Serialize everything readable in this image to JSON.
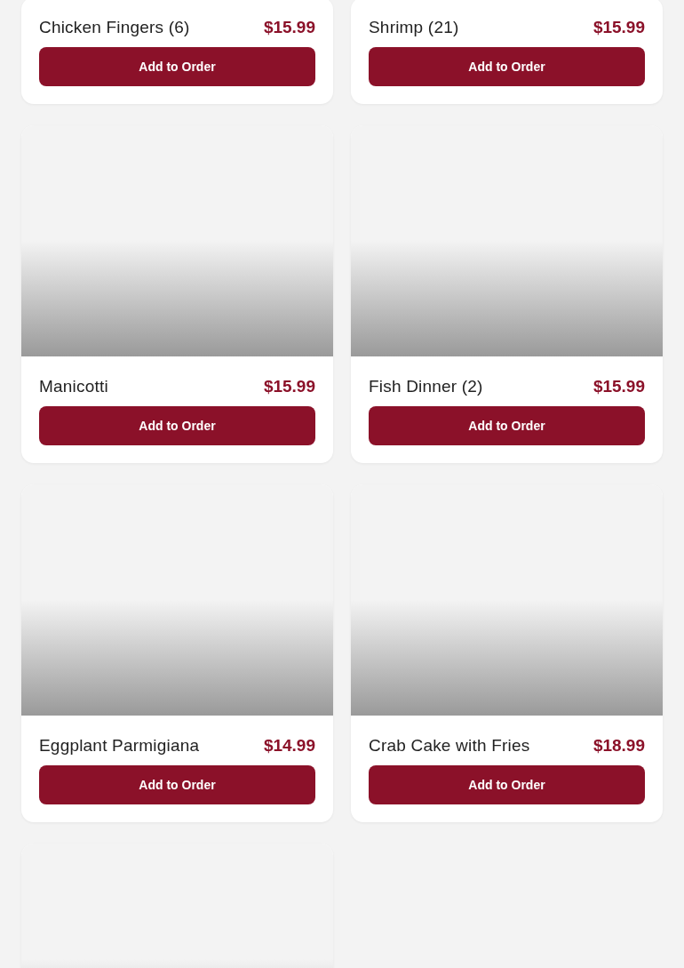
{
  "cut_off_cards": [
    {
      "name": "Chicken Fingers (6)",
      "price": "$15.99",
      "button": "Add to Order"
    },
    {
      "name": "Shrimp (21)",
      "price": "$15.99",
      "button": "Add to Order"
    }
  ],
  "menu_items": [
    {
      "name": "Manicotti",
      "price": "$15.99",
      "button": "Add to Order"
    },
    {
      "name": "Fish Dinner (2)",
      "price": "$15.99",
      "button": "Add to Order"
    },
    {
      "name": "Eggplant Parmigiana",
      "price": "$14.99",
      "button": "Add to Order"
    },
    {
      "name": "Crab Cake with Fries",
      "price": "$18.99",
      "button": "Add to Order"
    }
  ]
}
